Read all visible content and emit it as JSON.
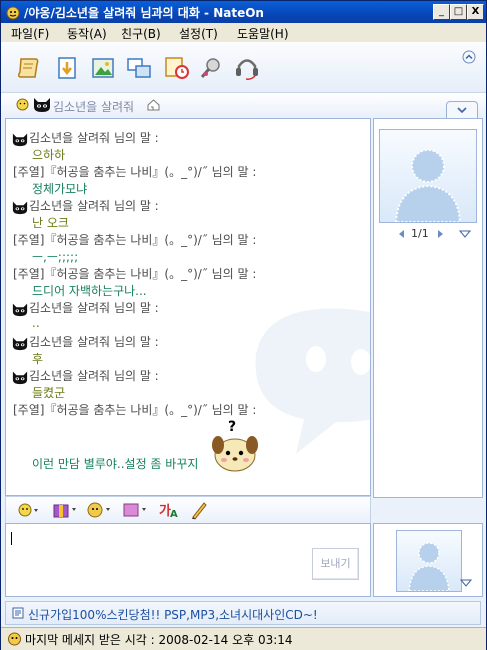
{
  "window": {
    "title": "/야옹/김소년을 살려줘 님과의 대화  - NateOn",
    "controls": {
      "minimize": "_",
      "maximize": "□",
      "close": "X"
    }
  },
  "menu": [
    "파일(F)",
    "동작(A)",
    "친구(B)",
    "설정(T)",
    "도움말(H)"
  ],
  "toolbar": {
    "icons": [
      "file-send-icon",
      "download-icon",
      "photo-icon",
      "screen-share-icon",
      "alarm-icon",
      "voice-chat-icon",
      "headset-icon"
    ],
    "collapse_icon": "up-chevron-icon"
  },
  "participants": {
    "name": "김소년을 살려줘"
  },
  "chat": {
    "speaker_suffix": "님의 말 :",
    "lines": [
      {
        "speaker": "김소년을 살려줘",
        "cat": true,
        "text": "으하하",
        "color": "olive"
      },
      {
        "speaker": "[주열]『허공을 춤추는 나비』(。_°)/˝",
        "cat": false,
        "text": "정체가모냐",
        "color": "green"
      },
      {
        "speaker": "김소년을 살려줘",
        "cat": true,
        "text": "난 오크",
        "color": "olive"
      },
      {
        "speaker": "[주열]『허공을 춤추는 나비』(。_°)/˝",
        "cat": false,
        "text": "ㅡ,ㅡ;;;;;",
        "color": "green"
      },
      {
        "speaker": "[주열]『허공을 춤추는 나비』(。_°)/˝",
        "cat": false,
        "text": "드디어 자백하는구나...",
        "color": "green"
      },
      {
        "speaker": "김소년을 살려줘",
        "cat": true,
        "text": "..",
        "color": "olive"
      },
      {
        "speaker": "김소년을 살려줘",
        "cat": true,
        "text": "후",
        "color": "olive"
      },
      {
        "speaker": "김소년을 살려줘",
        "cat": true,
        "text": "들켰군",
        "color": "olive"
      },
      {
        "speaker": "[주열]『허공을 춤추는 나비』(。_°)/˝",
        "cat": false,
        "text": "",
        "color": "green"
      }
    ],
    "last_message": "이런 만담 별루야..설정 좀 바꾸지"
  },
  "avatar_panel": {
    "page": "1/1"
  },
  "input": {
    "send_label": "보내기",
    "value": ""
  },
  "input_toolbar": [
    "emoticon-icon",
    "gift-icon",
    "character-icon",
    "flash-icon",
    "font-icon",
    "pen-icon"
  ],
  "ad": {
    "text": "신규가입100%스킨당첨!! PSP,MP3,소녀시대사인CD~!"
  },
  "status": {
    "text": "마지막 메세지 받은 시각 : 2008-02-14 오후 03:14"
  },
  "colors": {
    "title": "#0747b8",
    "msg_green": "#178060",
    "msg_olive": "#6b7a14",
    "accent": "#9fb5d9"
  }
}
